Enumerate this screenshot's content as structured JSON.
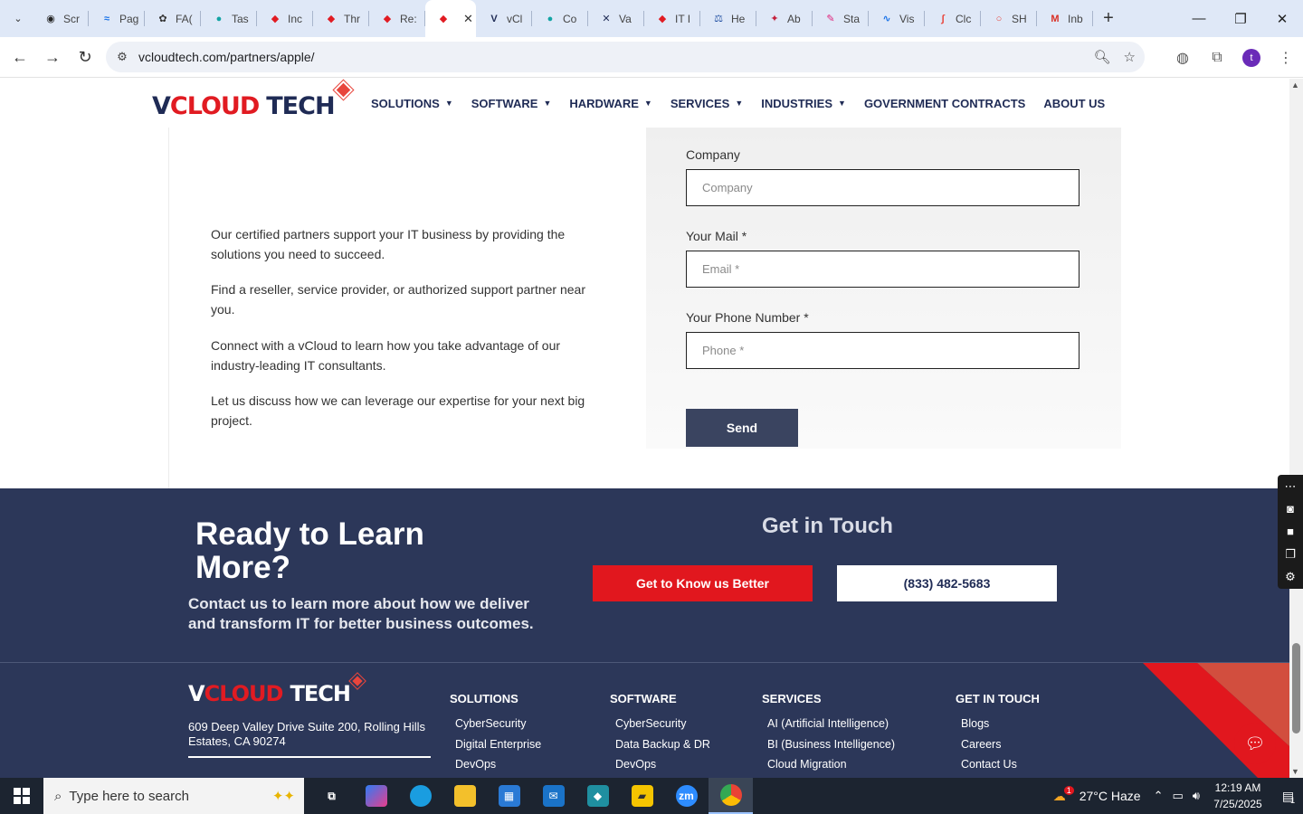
{
  "browser": {
    "tabs": [
      {
        "title": "Scr",
        "icon": "circle-logo-icon",
        "color": "#222222",
        "glyph": "◉"
      },
      {
        "title": "Pag",
        "icon": "wifi-logo-icon",
        "color": "#1a73e8",
        "glyph": "≈"
      },
      {
        "title": "FA(",
        "icon": "openai-icon",
        "color": "#333333",
        "glyph": "✿"
      },
      {
        "title": "Tas",
        "icon": "teal-circle-icon",
        "color": "#12a4a4",
        "glyph": "●"
      },
      {
        "title": "Inc",
        "icon": "diamond-tag-icon",
        "color": "#e11b22",
        "glyph": "◆"
      },
      {
        "title": "Thr",
        "icon": "diamond-tag-icon",
        "color": "#e11b22",
        "glyph": "◆"
      },
      {
        "title": "Re:",
        "icon": "diamond-tag-icon",
        "color": "#e11b22",
        "glyph": "◆"
      },
      {
        "title": "",
        "icon": "diamond-tag-icon",
        "color": "#e11b22",
        "glyph": "◆",
        "active": true
      },
      {
        "title": "vCl",
        "icon": "v-logo-icon",
        "color": "#1f2b55",
        "glyph": "V"
      },
      {
        "title": "Co",
        "icon": "teal-circle-icon",
        "color": "#12a4a4",
        "glyph": "●"
      },
      {
        "title": "Va",
        "icon": "x-logo-icon",
        "color": "#1f2b55",
        "glyph": "✕"
      },
      {
        "title": "IT I",
        "icon": "diamond-tag-icon",
        "color": "#e11b22",
        "glyph": "◆"
      },
      {
        "title": "He",
        "icon": "scale-icon",
        "color": "#1f4ea1",
        "glyph": "⚖"
      },
      {
        "title": "Ab",
        "icon": "red-logo-icon",
        "color": "#c4203b",
        "glyph": "✦"
      },
      {
        "title": "Sta",
        "icon": "pen-icon",
        "color": "#e0217a",
        "glyph": "✎"
      },
      {
        "title": "Vis",
        "icon": "pulse-icon",
        "color": "#1a73e8",
        "glyph": "∿"
      },
      {
        "title": "Clc",
        "icon": "wave-icon",
        "color": "#e8453c",
        "glyph": "∫"
      },
      {
        "title": "SH",
        "icon": "ring-icon",
        "color": "#e8453c",
        "glyph": "○"
      },
      {
        "title": "Inb",
        "icon": "gmail-icon",
        "color": "#d93025",
        "glyph": "M"
      }
    ],
    "url": "vcloudtech.com/partners/apple/"
  },
  "site": {
    "logo": {
      "v": "V",
      "cloud": "CLOUD",
      "tech": "TECH"
    },
    "nav": [
      {
        "label": "SOLUTIONS",
        "dropdown": true
      },
      {
        "label": "SOFTWARE",
        "dropdown": true
      },
      {
        "label": "HARDWARE",
        "dropdown": true
      },
      {
        "label": "SERVICES",
        "dropdown": true
      },
      {
        "label": "INDUSTRIES",
        "dropdown": true
      },
      {
        "label": "GOVERNMENT CONTRACTS",
        "dropdown": false
      },
      {
        "label": "ABOUT US",
        "dropdown": false
      }
    ]
  },
  "content": {
    "paragraphs": [
      "Our certified partners support your IT business by providing the solutions you need to succeed.",
      "Find a reseller, service provider, or authorized support partner near you.",
      "Connect with a vCloud to learn how you take advantage of our industry-leading IT consultants.",
      "Let us discuss how we can leverage our expertise for your next big project."
    ],
    "form": {
      "company_label": "Company",
      "company_placeholder": "Company",
      "mail_label": "Your Mail *",
      "mail_placeholder": "Email *",
      "phone_label": "Your Phone Number *",
      "phone_placeholder": "Phone *",
      "send": "Send"
    }
  },
  "cta": {
    "title": "Ready to Learn More?",
    "text": "Contact us to learn more about how we deliver and transform IT for better business outcomes.",
    "get_in_touch": "Get in Touch",
    "btn_primary": "Get to Know us Better",
    "btn_phone": "(833) 482-5683"
  },
  "footer": {
    "address": "609 Deep Valley Drive Suite 200, Rolling Hills Estates, CA 90274",
    "columns": [
      {
        "heading": "SOLUTIONS",
        "links": [
          "CyberSecurity",
          "Digital Enterprise",
          "DevOps"
        ]
      },
      {
        "heading": "SOFTWARE",
        "links": [
          "CyberSecurity",
          "Data Backup & DR",
          "DevOps"
        ]
      },
      {
        "heading": "SERVICES",
        "links": [
          "AI (Artificial Intelligence)",
          "BI (Business Intelligence)",
          "Cloud Migration"
        ]
      },
      {
        "heading": "GET IN TOUCH",
        "links": [
          "Blogs",
          "Careers",
          "Contact Us"
        ]
      }
    ]
  },
  "taskbar": {
    "search_placeholder": "Type here to search",
    "weather": "27°C  Haze",
    "weather_badge": "1",
    "time": "12:19 AM",
    "date": "7/25/2025",
    "notification_count": "1"
  },
  "colors": {
    "brand_navy": "#2c3759",
    "brand_red": "#e1171e"
  }
}
